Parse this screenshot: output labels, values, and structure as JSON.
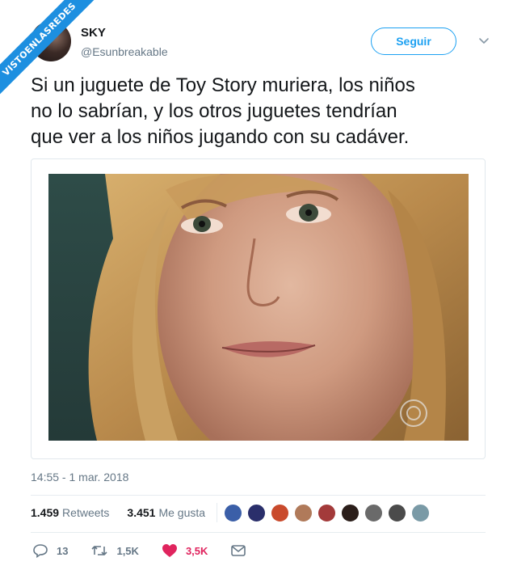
{
  "watermark": {
    "text": "VISTOENLASREDES"
  },
  "author": {
    "name": "SKY",
    "handle": "@Esunbreakable"
  },
  "follow_label": "Seguir",
  "tweet": {
    "lines": [
      "Si un juguete de Toy Story muriera, los niños",
      "no lo sabrían, y los otros juguetes tendrían",
      "que ver a los niños jugando con su cadáver."
    ]
  },
  "timestamp": "14:55 - 1 mar. 2018",
  "stats": {
    "retweets_count": "1.459",
    "retweets_label": "Retweets",
    "likes_count": "3.451",
    "likes_label": "Me gusta"
  },
  "actions": {
    "replies": "13",
    "retweets": "1,5K",
    "likes": "3,5K"
  },
  "colors": {
    "accent": "#1da1f2",
    "like": "#e0245e",
    "watermark": "#1d8fe0"
  },
  "icons": [
    "chevron-down-icon",
    "reply-icon",
    "retweet-icon",
    "heart-icon",
    "mail-icon"
  ]
}
